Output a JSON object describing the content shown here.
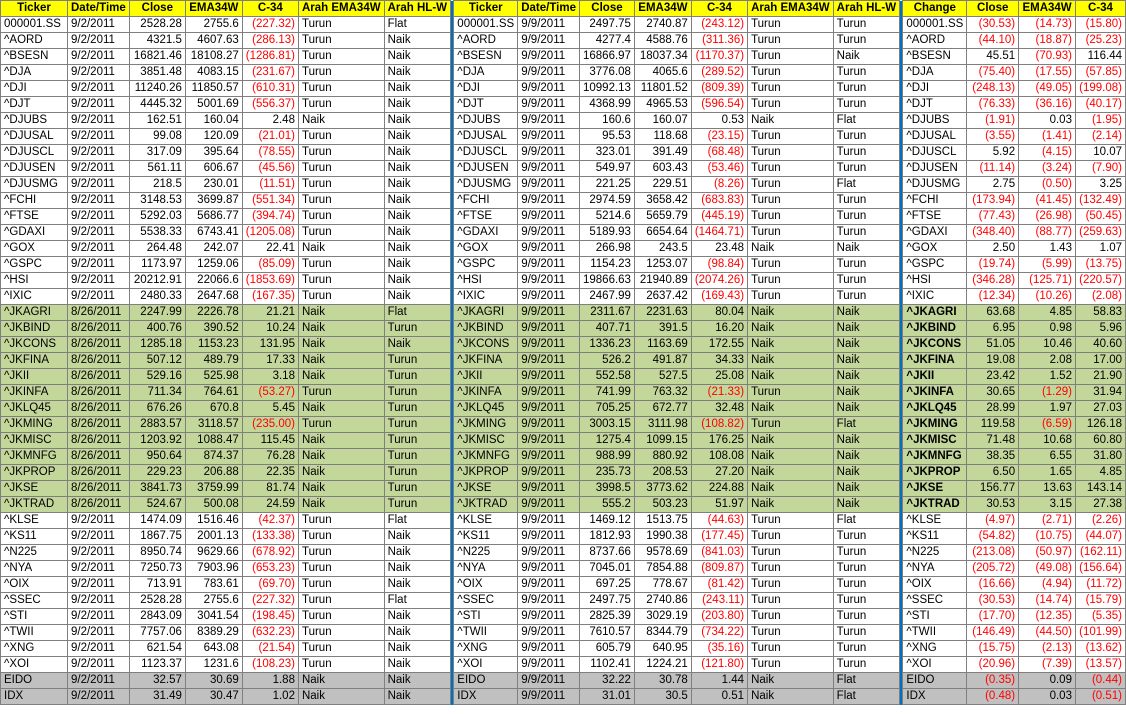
{
  "headers": [
    "Ticker",
    "Date/Time",
    "Close",
    "EMA34W",
    "C-34",
    "Arah EMA34W",
    "Arah HL-W",
    "Ticker",
    "Date/Time",
    "Close",
    "EMA34W",
    "C-34",
    "Arah EMA34W",
    "Arah HL-W",
    "Change",
    "Close",
    "EMA34W",
    "C-34"
  ],
  "rows": [
    {
      "g": 0,
      "c": [
        "000001.SS",
        "9/2/2011",
        "2528.28",
        "2755.6",
        "(227.32)",
        "Turun",
        "Flat",
        "000001.SS",
        "9/9/2011",
        "2497.75",
        "2740.87",
        "(243.12)",
        "Turun",
        "Turun",
        "000001.SS",
        "(30.53)",
        "(14.73)",
        "(15.80)"
      ]
    },
    {
      "g": 0,
      "c": [
        "^AORD",
        "9/2/2011",
        "4321.5",
        "4607.63",
        "(286.13)",
        "Turun",
        "Naik",
        "^AORD",
        "9/9/2011",
        "4277.4",
        "4588.76",
        "(311.36)",
        "Turun",
        "Turun",
        "^AORD",
        "(44.10)",
        "(18.87)",
        "(25.23)"
      ]
    },
    {
      "g": 0,
      "c": [
        "^BSESN",
        "9/2/2011",
        "16821.46",
        "18108.27",
        "(1286.81)",
        "Turun",
        "Naik",
        "^BSESN",
        "9/9/2011",
        "16866.97",
        "18037.34",
        "(1170.37)",
        "Turun",
        "Naik",
        "^BSESN",
        "45.51",
        "(70.93)",
        "116.44"
      ]
    },
    {
      "g": 0,
      "c": [
        "^DJA",
        "9/2/2011",
        "3851.48",
        "4083.15",
        "(231.67)",
        "Turun",
        "Naik",
        "^DJA",
        "9/9/2011",
        "3776.08",
        "4065.6",
        "(289.52)",
        "Turun",
        "Turun",
        "^DJA",
        "(75.40)",
        "(17.55)",
        "(57.85)"
      ]
    },
    {
      "g": 0,
      "c": [
        "^DJI",
        "9/2/2011",
        "11240.26",
        "11850.57",
        "(610.31)",
        "Turun",
        "Naik",
        "^DJI",
        "9/9/2011",
        "10992.13",
        "11801.52",
        "(809.39)",
        "Turun",
        "Turun",
        "^DJI",
        "(248.13)",
        "(49.05)",
        "(199.08)"
      ]
    },
    {
      "g": 0,
      "c": [
        "^DJT",
        "9/2/2011",
        "4445.32",
        "5001.69",
        "(556.37)",
        "Turun",
        "Naik",
        "^DJT",
        "9/9/2011",
        "4368.99",
        "4965.53",
        "(596.54)",
        "Turun",
        "Turun",
        "^DJT",
        "(76.33)",
        "(36.16)",
        "(40.17)"
      ]
    },
    {
      "g": 0,
      "c": [
        "^DJUBS",
        "9/2/2011",
        "162.51",
        "160.04",
        "2.48",
        "Naik",
        "Naik",
        "^DJUBS",
        "9/9/2011",
        "160.6",
        "160.07",
        "0.53",
        "Naik",
        "Flat",
        "^DJUBS",
        "(1.91)",
        "0.03",
        "(1.95)"
      ]
    },
    {
      "g": 0,
      "c": [
        "^DJUSAL",
        "9/2/2011",
        "99.08",
        "120.09",
        "(21.01)",
        "Turun",
        "Naik",
        "^DJUSAL",
        "9/9/2011",
        "95.53",
        "118.68",
        "(23.15)",
        "Turun",
        "Turun",
        "^DJUSAL",
        "(3.55)",
        "(1.41)",
        "(2.14)"
      ]
    },
    {
      "g": 0,
      "c": [
        "^DJUSCL",
        "9/2/2011",
        "317.09",
        "395.64",
        "(78.55)",
        "Turun",
        "Naik",
        "^DJUSCL",
        "9/9/2011",
        "323.01",
        "391.49",
        "(68.48)",
        "Turun",
        "Turun",
        "^DJUSCL",
        "5.92",
        "(4.15)",
        "10.07"
      ]
    },
    {
      "g": 0,
      "c": [
        "^DJUSEN",
        "9/2/2011",
        "561.11",
        "606.67",
        "(45.56)",
        "Turun",
        "Naik",
        "^DJUSEN",
        "9/9/2011",
        "549.97",
        "603.43",
        "(53.46)",
        "Turun",
        "Turun",
        "^DJUSEN",
        "(11.14)",
        "(3.24)",
        "(7.90)"
      ]
    },
    {
      "g": 0,
      "c": [
        "^DJUSMG",
        "9/2/2011",
        "218.5",
        "230.01",
        "(11.51)",
        "Turun",
        "Naik",
        "^DJUSMG",
        "9/9/2011",
        "221.25",
        "229.51",
        "(8.26)",
        "Turun",
        "Flat",
        "^DJUSMG",
        "2.75",
        "(0.50)",
        "3.25"
      ]
    },
    {
      "g": 0,
      "c": [
        "^FCHI",
        "9/2/2011",
        "3148.53",
        "3699.87",
        "(551.34)",
        "Turun",
        "Naik",
        "^FCHI",
        "9/9/2011",
        "2974.59",
        "3658.42",
        "(683.83)",
        "Turun",
        "Turun",
        "^FCHI",
        "(173.94)",
        "(41.45)",
        "(132.49)"
      ]
    },
    {
      "g": 0,
      "c": [
        "^FTSE",
        "9/2/2011",
        "5292.03",
        "5686.77",
        "(394.74)",
        "Turun",
        "Naik",
        "^FTSE",
        "9/9/2011",
        "5214.6",
        "5659.79",
        "(445.19)",
        "Turun",
        "Turun",
        "^FTSE",
        "(77.43)",
        "(26.98)",
        "(50.45)"
      ]
    },
    {
      "g": 0,
      "c": [
        "^GDAXI",
        "9/2/2011",
        "5538.33",
        "6743.41",
        "(1205.08)",
        "Turun",
        "Naik",
        "^GDAXI",
        "9/9/2011",
        "5189.93",
        "6654.64",
        "(1464.71)",
        "Turun",
        "Turun",
        "^GDAXI",
        "(348.40)",
        "(88.77)",
        "(259.63)"
      ]
    },
    {
      "g": 0,
      "c": [
        "^GOX",
        "9/2/2011",
        "264.48",
        "242.07",
        "22.41",
        "Naik",
        "Naik",
        "^GOX",
        "9/9/2011",
        "266.98",
        "243.5",
        "23.48",
        "Naik",
        "Naik",
        "^GOX",
        "2.50",
        "1.43",
        "1.07"
      ]
    },
    {
      "g": 0,
      "c": [
        "^GSPC",
        "9/2/2011",
        "1173.97",
        "1259.06",
        "(85.09)",
        "Turun",
        "Naik",
        "^GSPC",
        "9/9/2011",
        "1154.23",
        "1253.07",
        "(98.84)",
        "Turun",
        "Turun",
        "^GSPC",
        "(19.74)",
        "(5.99)",
        "(13.75)"
      ]
    },
    {
      "g": 0,
      "c": [
        "^HSI",
        "9/2/2011",
        "20212.91",
        "22066.6",
        "(1853.69)",
        "Turun",
        "Naik",
        "^HSI",
        "9/9/2011",
        "19866.63",
        "21940.89",
        "(2074.26)",
        "Turun",
        "Turun",
        "^HSI",
        "(346.28)",
        "(125.71)",
        "(220.57)"
      ]
    },
    {
      "g": 0,
      "c": [
        "^IXIC",
        "9/2/2011",
        "2480.33",
        "2647.68",
        "(167.35)",
        "Turun",
        "Naik",
        "^IXIC",
        "9/9/2011",
        "2467.99",
        "2637.42",
        "(169.43)",
        "Turun",
        "Turun",
        "^IXIC",
        "(12.34)",
        "(10.26)",
        "(2.08)"
      ]
    },
    {
      "g": 1,
      "c": [
        "^JKAGRI",
        "8/26/2011",
        "2247.99",
        "2226.78",
        "21.21",
        "Naik",
        "Flat",
        "^JKAGRI",
        "9/9/2011",
        "2311.67",
        "2231.63",
        "80.04",
        "Naik",
        "Naik",
        "^JKAGRI",
        "63.68",
        "4.85",
        "58.83"
      ]
    },
    {
      "g": 1,
      "c": [
        "^JKBIND",
        "8/26/2011",
        "400.76",
        "390.52",
        "10.24",
        "Naik",
        "Turun",
        "^JKBIND",
        "9/9/2011",
        "407.71",
        "391.5",
        "16.20",
        "Naik",
        "Naik",
        "^JKBIND",
        "6.95",
        "0.98",
        "5.96"
      ]
    },
    {
      "g": 1,
      "c": [
        "^JKCONS",
        "8/26/2011",
        "1285.18",
        "1153.23",
        "131.95",
        "Naik",
        "Naik",
        "^JKCONS",
        "9/9/2011",
        "1336.23",
        "1163.69",
        "172.55",
        "Naik",
        "Naik",
        "^JKCONS",
        "51.05",
        "10.46",
        "40.60"
      ]
    },
    {
      "g": 1,
      "c": [
        "^JKFINA",
        "8/26/2011",
        "507.12",
        "489.79",
        "17.33",
        "Naik",
        "Turun",
        "^JKFINA",
        "9/9/2011",
        "526.2",
        "491.87",
        "34.33",
        "Naik",
        "Naik",
        "^JKFINA",
        "19.08",
        "2.08",
        "17.00"
      ]
    },
    {
      "g": 1,
      "c": [
        "^JKII",
        "8/26/2011",
        "529.16",
        "525.98",
        "3.18",
        "Naik",
        "Turun",
        "^JKII",
        "9/9/2011",
        "552.58",
        "527.5",
        "25.08",
        "Naik",
        "Naik",
        "^JKII",
        "23.42",
        "1.52",
        "21.90"
      ]
    },
    {
      "g": 1,
      "c": [
        "^JKINFA",
        "8/26/2011",
        "711.34",
        "764.61",
        "(53.27)",
        "Turun",
        "Turun",
        "^JKINFA",
        "9/9/2011",
        "741.99",
        "763.32",
        "(21.33)",
        "Turun",
        "Naik",
        "^JKINFA",
        "30.65",
        "(1.29)",
        "31.94"
      ]
    },
    {
      "g": 1,
      "c": [
        "^JKLQ45",
        "8/26/2011",
        "676.26",
        "670.8",
        "5.45",
        "Naik",
        "Turun",
        "^JKLQ45",
        "9/9/2011",
        "705.25",
        "672.77",
        "32.48",
        "Naik",
        "Naik",
        "^JKLQ45",
        "28.99",
        "1.97",
        "27.03"
      ]
    },
    {
      "g": 1,
      "c": [
        "^JKMING",
        "8/26/2011",
        "2883.57",
        "3118.57",
        "(235.00)",
        "Turun",
        "Turun",
        "^JKMING",
        "9/9/2011",
        "3003.15",
        "3111.98",
        "(108.82)",
        "Turun",
        "Flat",
        "^JKMING",
        "119.58",
        "(6.59)",
        "126.18"
      ]
    },
    {
      "g": 1,
      "c": [
        "^JKMISC",
        "8/26/2011",
        "1203.92",
        "1088.47",
        "115.45",
        "Naik",
        "Turun",
        "^JKMISC",
        "9/9/2011",
        "1275.4",
        "1099.15",
        "176.25",
        "Naik",
        "Naik",
        "^JKMISC",
        "71.48",
        "10.68",
        "60.80"
      ]
    },
    {
      "g": 1,
      "c": [
        "^JKMNFG",
        "8/26/2011",
        "950.64",
        "874.37",
        "76.28",
        "Naik",
        "Turun",
        "^JKMNFG",
        "9/9/2011",
        "988.99",
        "880.92",
        "108.08",
        "Naik",
        "Naik",
        "^JKMNFG",
        "38.35",
        "6.55",
        "31.80"
      ]
    },
    {
      "g": 1,
      "c": [
        "^JKPROP",
        "8/26/2011",
        "229.23",
        "206.88",
        "22.35",
        "Naik",
        "Turun",
        "^JKPROP",
        "9/9/2011",
        "235.73",
        "208.53",
        "27.20",
        "Naik",
        "Naik",
        "^JKPROP",
        "6.50",
        "1.65",
        "4.85"
      ]
    },
    {
      "g": 1,
      "c": [
        "^JKSE",
        "8/26/2011",
        "3841.73",
        "3759.99",
        "81.74",
        "Naik",
        "Turun",
        "^JKSE",
        "9/9/2011",
        "3998.5",
        "3773.62",
        "224.88",
        "Naik",
        "Naik",
        "^JKSE",
        "156.77",
        "13.63",
        "143.14"
      ]
    },
    {
      "g": 1,
      "c": [
        "^JKTRAD",
        "8/26/2011",
        "524.67",
        "500.08",
        "24.59",
        "Naik",
        "Turun",
        "^JKTRAD",
        "9/9/2011",
        "555.2",
        "503.23",
        "51.97",
        "Naik",
        "Naik",
        "^JKTRAD",
        "30.53",
        "3.15",
        "27.38"
      ]
    },
    {
      "g": 0,
      "c": [
        "^KLSE",
        "9/2/2011",
        "1474.09",
        "1516.46",
        "(42.37)",
        "Turun",
        "Flat",
        "^KLSE",
        "9/9/2011",
        "1469.12",
        "1513.75",
        "(44.63)",
        "Turun",
        "Flat",
        "^KLSE",
        "(4.97)",
        "(2.71)",
        "(2.26)"
      ]
    },
    {
      "g": 0,
      "c": [
        "^KS11",
        "9/2/2011",
        "1867.75",
        "2001.13",
        "(133.38)",
        "Turun",
        "Naik",
        "^KS11",
        "9/9/2011",
        "1812.93",
        "1990.38",
        "(177.45)",
        "Turun",
        "Turun",
        "^KS11",
        "(54.82)",
        "(10.75)",
        "(44.07)"
      ]
    },
    {
      "g": 0,
      "c": [
        "^N225",
        "9/2/2011",
        "8950.74",
        "9629.66",
        "(678.92)",
        "Turun",
        "Naik",
        "^N225",
        "9/9/2011",
        "8737.66",
        "9578.69",
        "(841.03)",
        "Turun",
        "Turun",
        "^N225",
        "(213.08)",
        "(50.97)",
        "(162.11)"
      ]
    },
    {
      "g": 0,
      "c": [
        "^NYA",
        "9/2/2011",
        "7250.73",
        "7903.96",
        "(653.23)",
        "Turun",
        "Naik",
        "^NYA",
        "9/9/2011",
        "7045.01",
        "7854.88",
        "(809.87)",
        "Turun",
        "Turun",
        "^NYA",
        "(205.72)",
        "(49.08)",
        "(156.64)"
      ]
    },
    {
      "g": 0,
      "c": [
        "^OIX",
        "9/2/2011",
        "713.91",
        "783.61",
        "(69.70)",
        "Turun",
        "Naik",
        "^OIX",
        "9/9/2011",
        "697.25",
        "778.67",
        "(81.42)",
        "Turun",
        "Turun",
        "^OIX",
        "(16.66)",
        "(4.94)",
        "(11.72)"
      ]
    },
    {
      "g": 0,
      "c": [
        "^SSEC",
        "9/2/2011",
        "2528.28",
        "2755.6",
        "(227.32)",
        "Turun",
        "Flat",
        "^SSEC",
        "9/9/2011",
        "2497.75",
        "2740.86",
        "(243.11)",
        "Turun",
        "Turun",
        "^SSEC",
        "(30.53)",
        "(14.74)",
        "(15.79)"
      ]
    },
    {
      "g": 0,
      "c": [
        "^STI",
        "9/2/2011",
        "2843.09",
        "3041.54",
        "(198.45)",
        "Turun",
        "Naik",
        "^STI",
        "9/9/2011",
        "2825.39",
        "3029.19",
        "(203.80)",
        "Turun",
        "Turun",
        "^STI",
        "(17.70)",
        "(12.35)",
        "(5.35)"
      ]
    },
    {
      "g": 0,
      "c": [
        "^TWII",
        "9/2/2011",
        "7757.06",
        "8389.29",
        "(632.23)",
        "Turun",
        "Naik",
        "^TWII",
        "9/9/2011",
        "7610.57",
        "8344.79",
        "(734.22)",
        "Turun",
        "Turun",
        "^TWII",
        "(146.49)",
        "(44.50)",
        "(101.99)"
      ]
    },
    {
      "g": 0,
      "c": [
        "^XNG",
        "9/2/2011",
        "621.54",
        "643.08",
        "(21.54)",
        "Turun",
        "Naik",
        "^XNG",
        "9/9/2011",
        "605.79",
        "640.95",
        "(35.16)",
        "Turun",
        "Turun",
        "^XNG",
        "(15.75)",
        "(2.13)",
        "(13.62)"
      ]
    },
    {
      "g": 0,
      "c": [
        "^XOI",
        "9/2/2011",
        "1123.37",
        "1231.6",
        "(108.23)",
        "Turun",
        "Naik",
        "^XOI",
        "9/9/2011",
        "1102.41",
        "1224.21",
        "(121.80)",
        "Turun",
        "Turun",
        "^XOI",
        "(20.96)",
        "(7.39)",
        "(13.57)"
      ]
    },
    {
      "g": 2,
      "c": [
        "EIDO",
        "9/2/2011",
        "32.57",
        "30.69",
        "1.88",
        "Naik",
        "Naik",
        "EIDO",
        "9/9/2011",
        "32.22",
        "30.78",
        "1.44",
        "Naik",
        "Flat",
        "EIDO",
        "(0.35)",
        "0.09",
        "(0.44)"
      ]
    },
    {
      "g": 2,
      "c": [
        "IDX",
        "9/2/2011",
        "31.49",
        "30.47",
        "1.02",
        "Naik",
        "Naik",
        "IDX",
        "9/9/2011",
        "31.01",
        "30.5",
        "0.51",
        "Naik",
        "Flat",
        "IDX",
        "(0.48)",
        "0.03",
        "(0.51)"
      ]
    }
  ]
}
